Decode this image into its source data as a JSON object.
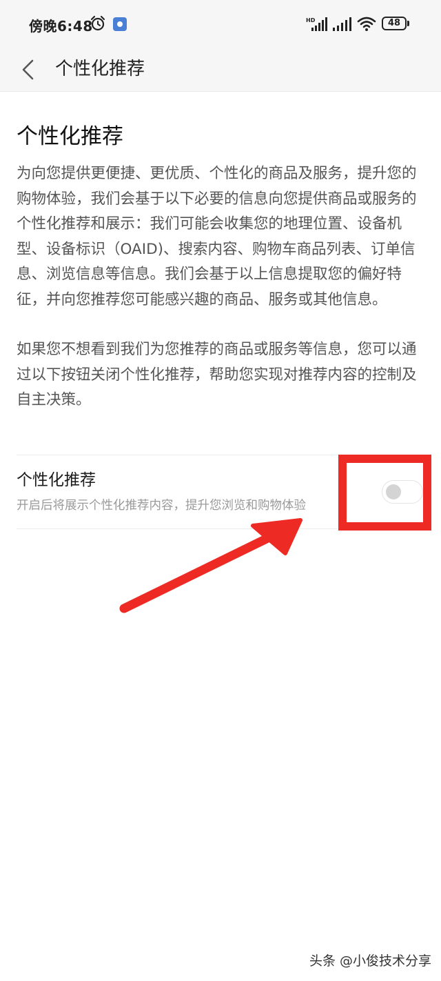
{
  "status_bar": {
    "time": "傍晚6:48",
    "battery": "48",
    "icons": [
      "alarm-icon",
      "app-notification-icon",
      "hd-signal-icon",
      "signal-icon",
      "wifi-icon",
      "battery-icon"
    ]
  },
  "app_bar": {
    "back_icon": "chevron-left-icon",
    "title": "个性化推荐"
  },
  "content": {
    "heading": "个性化推荐",
    "paragraph1": "为向您提供更便捷、更优质、个性化的商品及服务，提升您的购物体验，我们会基于以下必要的信息向您提供商品或服务的个性化推荐和展示：我们可能会收集您的地理位置、设备机型、设备标识（OAID)、搜索内容、购物车商品列表、订单信息、浏览信息等信息。我们会基于以上信息提取您的偏好特征，并向您推荐您可能感兴趣的商品、服务或其他信息。",
    "paragraph2": "如果您不想看到我们为您推荐的商品或服务等信息，您可以通过以下按钮关闭个性化推荐，帮助您实现对推荐内容的控制及自主决策。"
  },
  "setting": {
    "title": "个性化推荐",
    "description": "开启后将展示个性化推荐内容，提升您浏览和购物体验",
    "enabled": false
  },
  "annotation": {
    "highlight_color": "#ee2a24",
    "arrow_color": "#ee2a24"
  },
  "watermark": "头条 @小俊技术分享"
}
